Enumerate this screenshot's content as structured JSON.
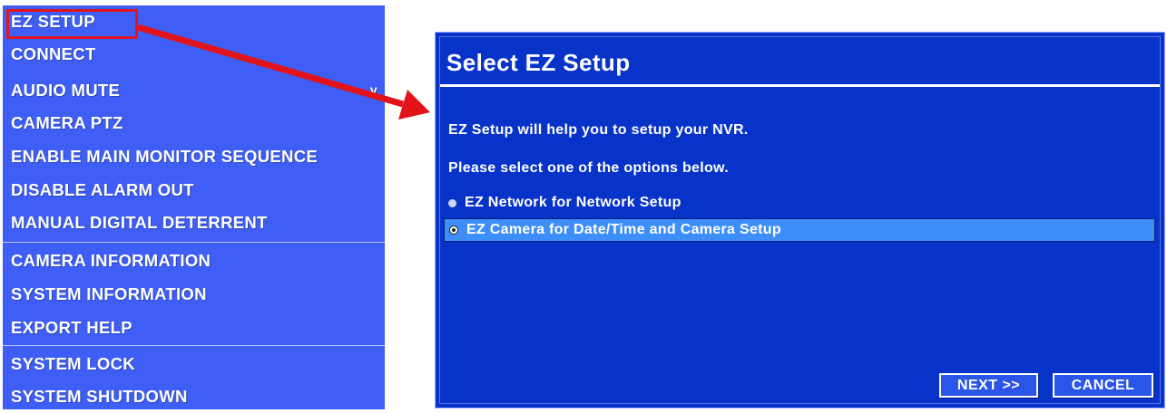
{
  "menu": {
    "items": [
      {
        "label": "EZ SETUP"
      },
      {
        "label": "CONNECT"
      },
      {
        "label": "AUDIO MUTE",
        "check": "v"
      },
      {
        "label": "CAMERA PTZ"
      },
      {
        "label": "ENABLE MAIN MONITOR SEQUENCE"
      },
      {
        "label": "DISABLE ALARM OUT"
      },
      {
        "label": "MANUAL DIGITAL DETERRENT"
      },
      {
        "label": "CAMERA INFORMATION"
      },
      {
        "label": "SYSTEM INFORMATION"
      },
      {
        "label": "EXPORT HELP"
      },
      {
        "label": "SYSTEM LOCK"
      },
      {
        "label": "SYSTEM SHUTDOWN"
      }
    ]
  },
  "dialog": {
    "title": "Select EZ Setup",
    "line1": "EZ Setup will help you to setup your NVR.",
    "line2": "Please select one of the options below.",
    "options": [
      {
        "label": "EZ Network for Network Setup",
        "selected": false
      },
      {
        "label": "EZ Camera for Date/Time and Camera Setup",
        "selected": true
      }
    ],
    "next_label": "NEXT >>",
    "cancel_label": "CANCEL"
  },
  "colors": {
    "menu_bg": "#3e5ef5",
    "dialog_bg": "#0833c9",
    "selected_bg": "#3d8ef8",
    "callout": "#e2141a"
  }
}
